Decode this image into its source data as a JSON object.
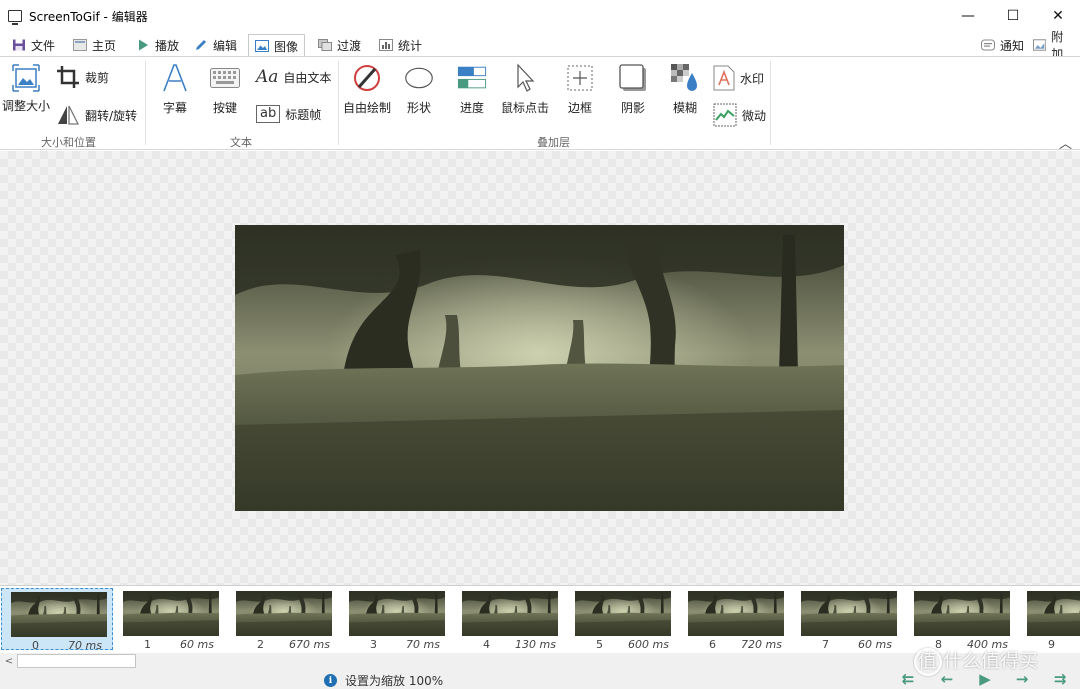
{
  "window": {
    "title": "ScreenToGif - 编辑器",
    "minimize": "—",
    "maximize": "☐",
    "close": "✕"
  },
  "tabs": [
    {
      "label": "文件",
      "icon": "save-icon"
    },
    {
      "label": "主页",
      "icon": "home-icon"
    },
    {
      "label": "播放",
      "icon": "play-icon"
    },
    {
      "label": "编辑",
      "icon": "pencil-icon"
    },
    {
      "label": "图像",
      "icon": "image-icon",
      "active": true
    },
    {
      "label": "过渡",
      "icon": "transition-icon"
    },
    {
      "label": "统计",
      "icon": "stats-icon"
    }
  ],
  "top_right": {
    "notify": "通知",
    "attach": "附加"
  },
  "ribbon": {
    "size_group": {
      "label": "大小和位置",
      "resize": "调整大小",
      "crop": "裁剪",
      "flip": "翻转/旋转"
    },
    "text_group": {
      "label": "文本",
      "caption": "字幕",
      "key_strokes": "按键",
      "free_text": "自由文本",
      "title_frame": "标题帧",
      "aa_glyph": "Aa",
      "ab_glyph": "ab"
    },
    "overlay_group": {
      "label": "叠加层",
      "free_drawing": "自由绘制",
      "shapes": "形状",
      "progress": "进度",
      "mouse_clicks": "鼠标点击",
      "border": "边框",
      "shadow": "阴影",
      "obfuscate": "模糊",
      "watermark": "水印",
      "cinemagraph": "微动"
    },
    "collapse_glyph": "︿"
  },
  "frames": [
    {
      "index": "0",
      "delay": "70 ms"
    },
    {
      "index": "1",
      "delay": "60 ms"
    },
    {
      "index": "2",
      "delay": "670 ms"
    },
    {
      "index": "3",
      "delay": "70 ms"
    },
    {
      "index": "4",
      "delay": "130 ms"
    },
    {
      "index": "5",
      "delay": "600 ms"
    },
    {
      "index": "6",
      "delay": "720 ms"
    },
    {
      "index": "7",
      "delay": "60 ms"
    },
    {
      "index": "8",
      "delay": "400 ms"
    },
    {
      "index": "9",
      "delay": ""
    }
  ],
  "status": {
    "message": "设置为缩放 100%",
    "info_glyph": "i"
  },
  "scroll_arrow": "<",
  "nav": {
    "first": "⇇",
    "prev": "←",
    "play": "▶",
    "next": "→",
    "last": "⇉"
  },
  "overlay_watermark": "值 什么值得买",
  "colors": {
    "accent": "#3a8fd6",
    "selected_bg": "#cde6f7",
    "nav_green": "#4a9a82",
    "info_blue": "#1f6fb2"
  }
}
